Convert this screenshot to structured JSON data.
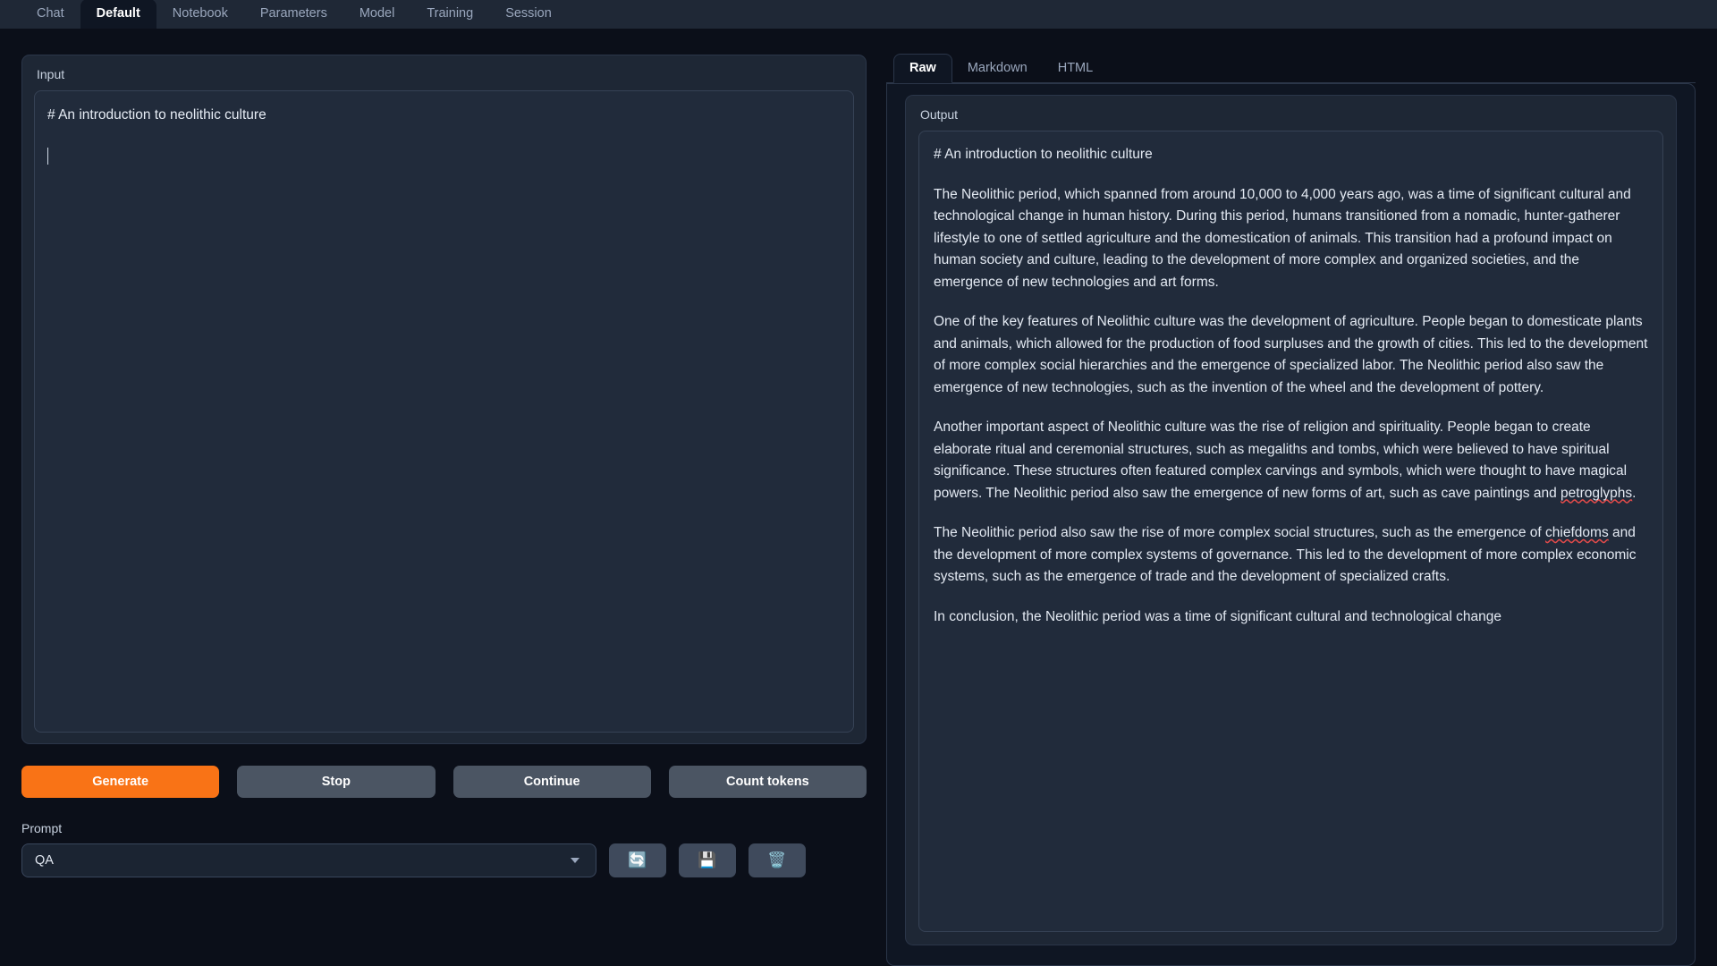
{
  "topbar": {
    "tabs": [
      {
        "label": "Chat",
        "active": false
      },
      {
        "label": "Default",
        "active": true
      },
      {
        "label": "Notebook",
        "active": false
      },
      {
        "label": "Parameters",
        "active": false
      },
      {
        "label": "Model",
        "active": false
      },
      {
        "label": "Training",
        "active": false
      },
      {
        "label": "Session",
        "active": false
      }
    ]
  },
  "input": {
    "label": "Input",
    "value": "# An introduction to neolithic culture"
  },
  "actions": {
    "generate": "Generate",
    "stop": "Stop",
    "continue": "Continue",
    "count_tokens": "Count tokens"
  },
  "prompt": {
    "label": "Prompt",
    "selected": "QA",
    "refresh_icon": "refresh-icon",
    "save_icon": "floppy-disk-icon",
    "delete_icon": "trash-icon"
  },
  "output": {
    "tabs": [
      {
        "label": "Raw",
        "active": true
      },
      {
        "label": "Markdown",
        "active": false
      },
      {
        "label": "HTML",
        "active": false
      }
    ],
    "label": "Output",
    "paragraphs": [
      "# An introduction to neolithic culture",
      "The Neolithic period, which spanned from around 10,000 to 4,000 years ago, was a time of significant cultural and technological change in human history. During this period, humans transitioned from a nomadic, hunter-gatherer lifestyle to one of settled agriculture and the domestication of animals. This transition had a profound impact on human society and culture, leading to the development of more complex and organized societies, and the emergence of new technologies and art forms.",
      "One of the key features of Neolithic culture was the development of agriculture. People began to domesticate plants and animals, which allowed for the production of food surpluses and the growth of cities. This led to the development of more complex social hierarchies and the emergence of specialized labor. The Neolithic period also saw the emergence of new technologies, such as the invention of the wheel and the development of pottery.",
      "Another important aspect of Neolithic culture was the rise of religion and spirituality. People began to create elaborate ritual and ceremonial structures, such as megaliths and tombs, which were believed to have spiritual significance. These structures often featured complex carvings and symbols, which were thought to have magical powers. The Neolithic period also saw the emergence of new forms of art, such as cave paintings and petroglyphs.",
      "The Neolithic period also saw the rise of more complex social structures, such as the emergence of chiefdoms and the development of more complex systems of governance. This led to the development of more complex economic systems, such as the emergence of trade and the development of specialized crafts.",
      "In conclusion, the Neolithic period was a time of significant cultural and technological change"
    ],
    "misspelled_words": [
      "petroglyphs",
      "chiefdoms"
    ]
  },
  "colors": {
    "page_background": "#0b0f19",
    "panel_background": "#1e2735",
    "field_background": "#212b3b",
    "accent_orange": "#f97316",
    "button_gray": "#4b5563",
    "text_primary": "#e3e9f2",
    "text_muted": "#9aa7bd",
    "spellcheck_red": "#e04a4a"
  }
}
